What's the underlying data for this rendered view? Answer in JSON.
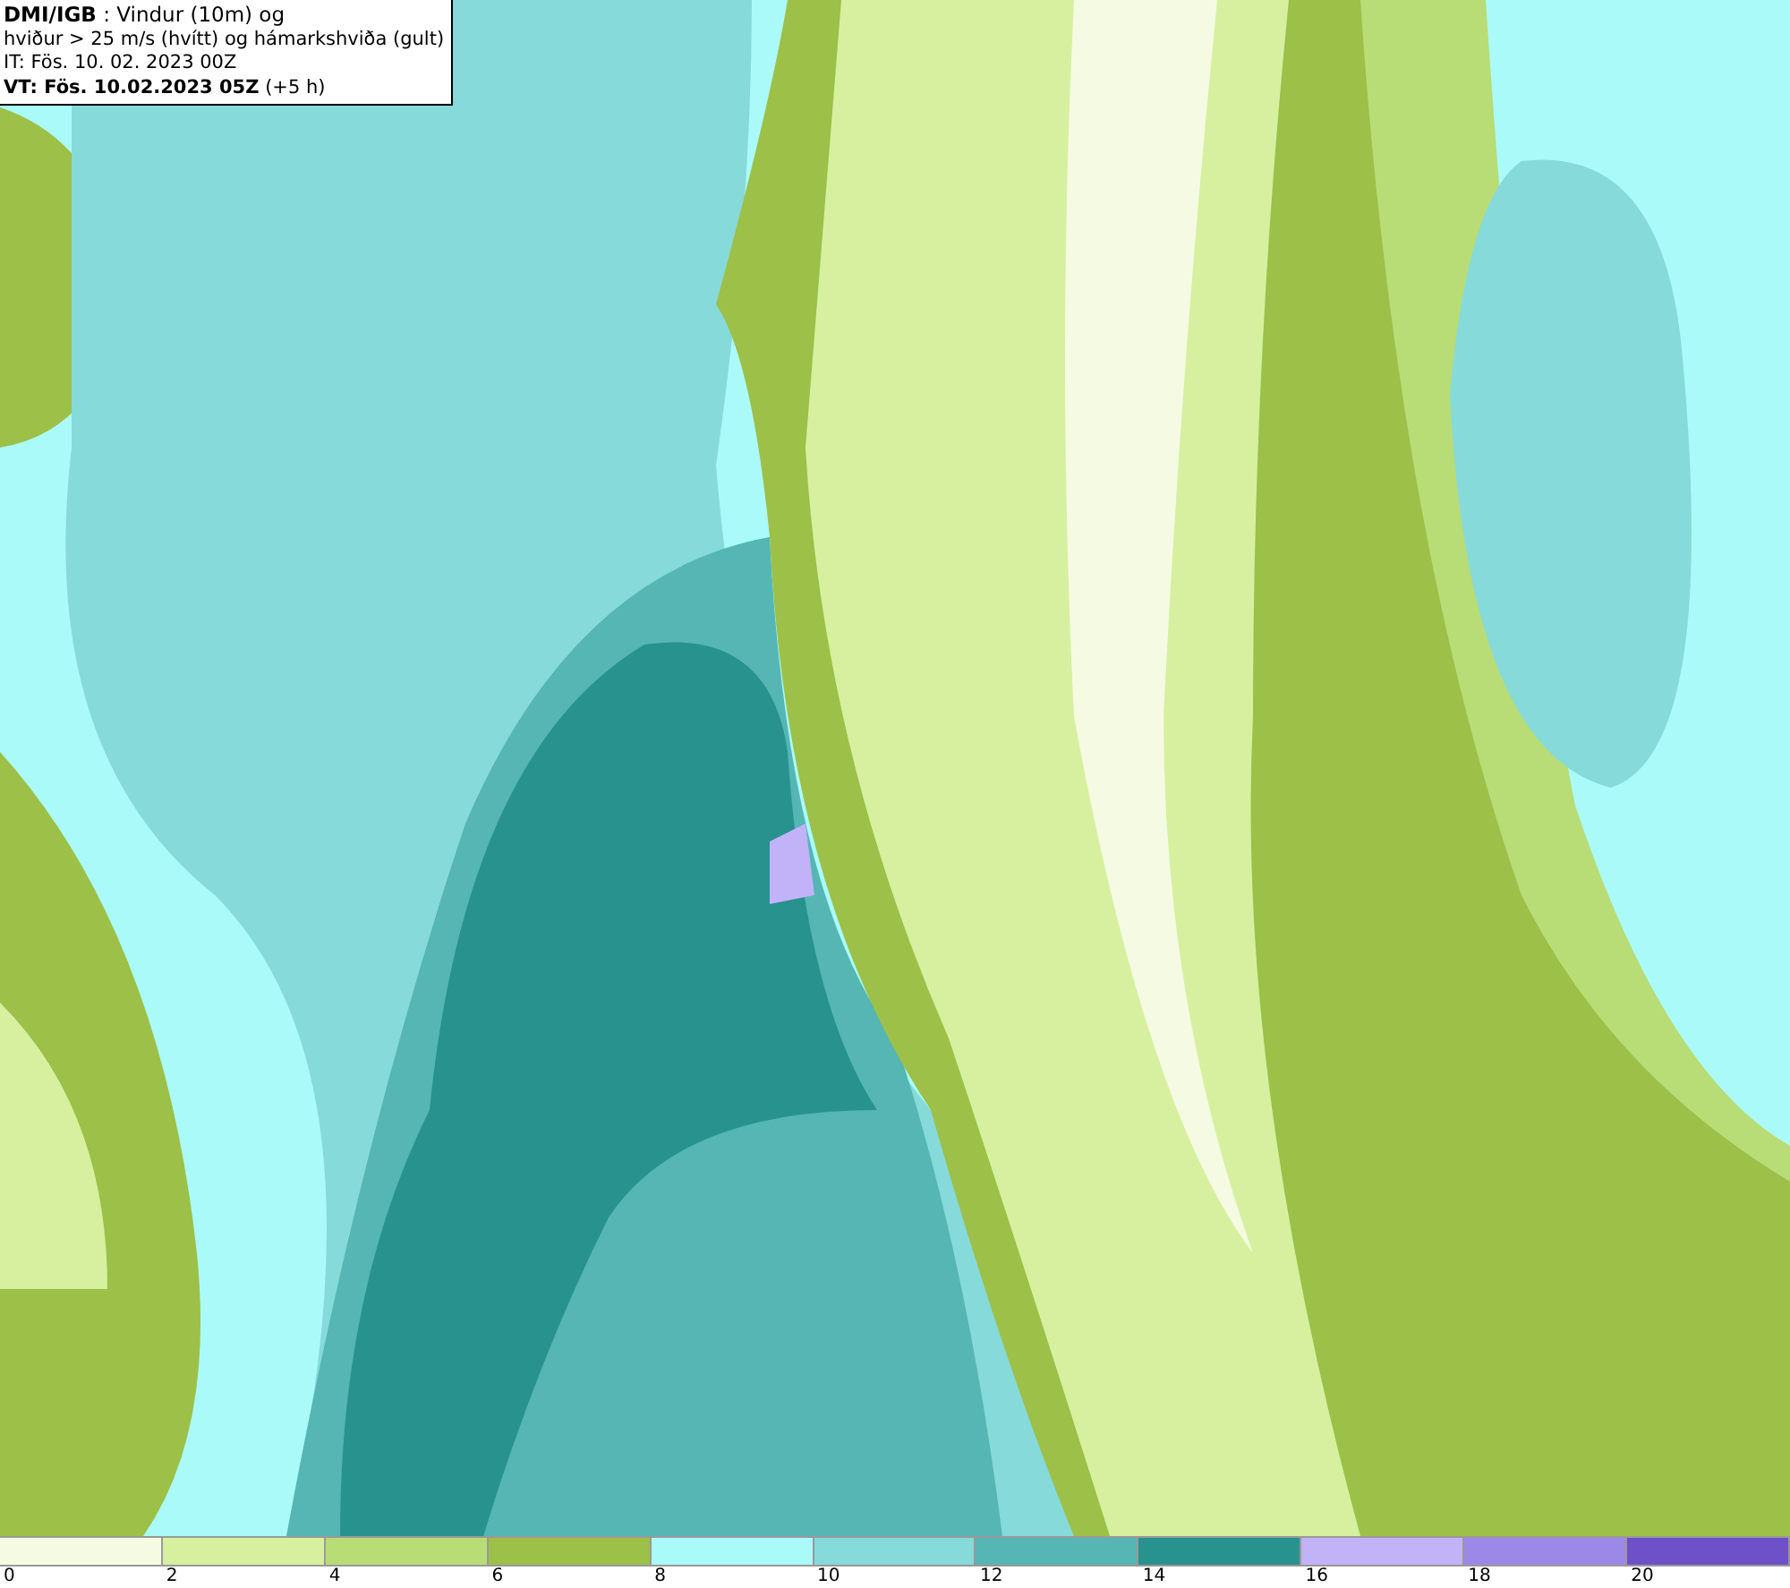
{
  "title_box": {
    "lines": [
      "**DMI/IGB** : Vindur (10m) og",
      "hviður > 25 m/s (hvítt) og hámarkshviða (gult)",
      "IT: Fös. 10. 02. 2023 00Z",
      "**VT: Fös. 10.02.2023 05Z** (+5 h)"
    ]
  },
  "legend": {
    "bins": [
      {
        "label": "0",
        "color": "#f5fbe2"
      },
      {
        "label": "2",
        "color": "#d6f0a0"
      },
      {
        "label": "4",
        "color": "#b8dc76"
      },
      {
        "label": "6",
        "color": "#9cc048"
      },
      {
        "label": "8",
        "color": "#abfafa"
      },
      {
        "label": "10",
        "color": "#86dada"
      },
      {
        "label": "12",
        "color": "#55b6b4"
      },
      {
        "label": "14",
        "color": "#28928e"
      },
      {
        "label": "16",
        "color": "#c2b2f8"
      },
      {
        "label": "18",
        "color": "#9c88e6"
      },
      {
        "label": "20",
        "color": "#6e50c8"
      }
    ]
  }
}
